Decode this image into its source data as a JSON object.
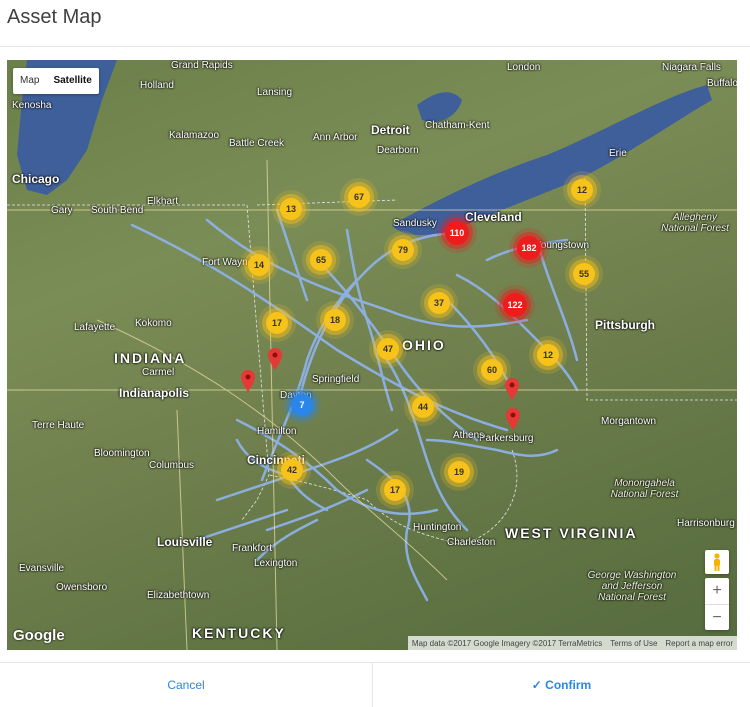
{
  "title": "Asset Map",
  "map": {
    "type_toggle": {
      "map": "Map",
      "satellite": "Satellite"
    },
    "attribution": {
      "data": "Map data ©2017 Google Imagery ©2017 TerraMetrics",
      "terms": "Terms of Use",
      "report": "Report a map error"
    },
    "logo": "Google",
    "zoom_in": "+",
    "zoom_out": "−",
    "labels": {
      "states": [
        "INDIANA",
        "OHIO",
        "WEST VIRGINIA",
        "KENTUCKY"
      ],
      "cities": [
        "Chicago",
        "Gary",
        "South Bend",
        "Elkhart",
        "Grand Rapids",
        "Holland",
        "Lansing",
        "Kalamazoo",
        "Battle Creek",
        "Ann Arbor",
        "Detroit",
        "Dearborn",
        "Chatham-Kent",
        "London",
        "Kenosha",
        "Fort Wayne",
        "Lafayette",
        "Kokomo",
        "Carmel",
        "Indianapolis",
        "Terre Haute",
        "Bloomington",
        "Columbus",
        "Cincinnati",
        "Hamilton",
        "Dayton",
        "Springfield",
        "Sandusky",
        "Cleveland",
        "Youngstown",
        "Erie",
        "Pittsburgh",
        "Morgantown",
        "Parkersburg",
        "Athens",
        "Huntington",
        "Charleston",
        "Lexington",
        "Frankfort",
        "Louisville",
        "Evansville",
        "Owensboro",
        "Elizabethtown",
        "Harrisonburg",
        "Niagara Falls",
        "Buffalo"
      ],
      "forests": [
        "Allegheny National Forest",
        "Monongahela National Forest",
        "George Washington and Jefferson National Forest"
      ]
    },
    "clusters": [
      {
        "count": "67",
        "color": "yellow"
      },
      {
        "count": "13",
        "color": "yellow"
      },
      {
        "count": "110",
        "color": "red"
      },
      {
        "count": "182",
        "color": "red"
      },
      {
        "count": "12",
        "color": "yellow"
      },
      {
        "count": "79",
        "color": "yellow"
      },
      {
        "count": "65",
        "color": "yellow"
      },
      {
        "count": "14",
        "color": "yellow"
      },
      {
        "count": "55",
        "color": "yellow"
      },
      {
        "count": "37",
        "color": "yellow"
      },
      {
        "count": "122",
        "color": "red"
      },
      {
        "count": "17",
        "color": "yellow"
      },
      {
        "count": "18",
        "color": "yellow"
      },
      {
        "count": "47",
        "color": "yellow"
      },
      {
        "count": "12",
        "color": "yellow"
      },
      {
        "count": "60",
        "color": "yellow"
      },
      {
        "count": "7",
        "color": "blue"
      },
      {
        "count": "44",
        "color": "yellow"
      },
      {
        "count": "42",
        "color": "yellow"
      },
      {
        "count": "19",
        "color": "yellow"
      },
      {
        "count": "17",
        "color": "yellow"
      }
    ]
  },
  "footer": {
    "cancel": "Cancel",
    "confirm": "✓ Confirm"
  },
  "colors": {
    "accent": "#2a86e8",
    "cluster_yellow": "#f7c21a",
    "cluster_red": "#ee1c1c",
    "cluster_blue": "#2a86e8",
    "pipeline": "#8fb4f0"
  }
}
